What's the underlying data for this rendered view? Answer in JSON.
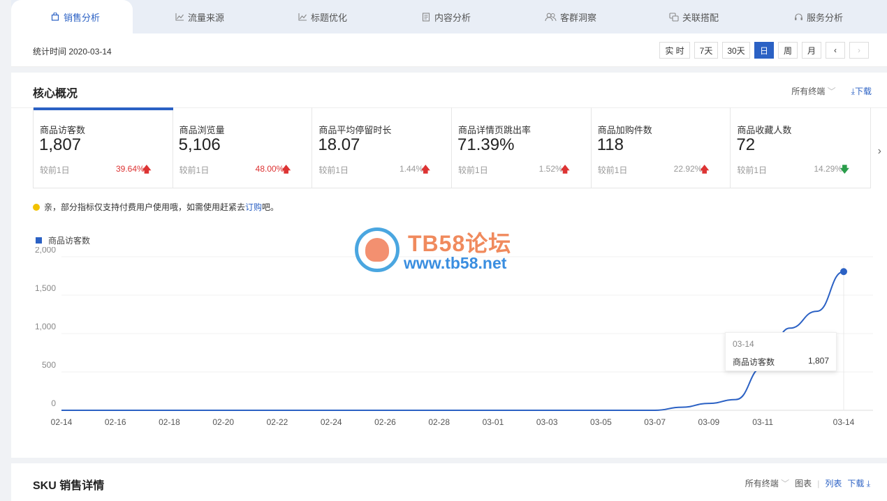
{
  "tabs": [
    {
      "label": "销售分析",
      "icon": "bag-icon",
      "active": true
    },
    {
      "label": "流量来源",
      "icon": "line-chart-icon"
    },
    {
      "label": "标题优化",
      "icon": "line-chart-icon"
    },
    {
      "label": "内容分析",
      "icon": "document-icon"
    },
    {
      "label": "客群洞察",
      "icon": "users-icon"
    },
    {
      "label": "关联搭配",
      "icon": "link-icon"
    },
    {
      "label": "服务分析",
      "icon": "headset-icon"
    }
  ],
  "header": {
    "stat_time": "统计时间 2020-03-14",
    "periods": [
      "实 时",
      "7天",
      "30天",
      "日",
      "周",
      "月"
    ],
    "active_period": "日",
    "prev": "‹",
    "next": "›"
  },
  "core": {
    "title": "核心概况",
    "terminal": "所有终端",
    "download": "下载",
    "cards": [
      {
        "label": "商品访客数",
        "value": "1,807",
        "compare": "较前1日",
        "pct": "39.64%",
        "trend": "up",
        "highlight": true
      },
      {
        "label": "商品浏览量",
        "value": "5,106",
        "compare": "较前1日",
        "pct": "48.00%",
        "trend": "up",
        "highlight": true
      },
      {
        "label": "商品平均停留时长",
        "value": "18.07",
        "compare": "较前1日",
        "pct": "1.44%",
        "trend": "up",
        "highlight": false
      },
      {
        "label": "商品详情页跳出率",
        "value": "71.39%",
        "compare": "较前1日",
        "pct": "1.52%",
        "trend": "up",
        "highlight": false
      },
      {
        "label": "商品加购件数",
        "value": "118",
        "compare": "较前1日",
        "pct": "22.92%",
        "trend": "up",
        "highlight": false
      },
      {
        "label": "商品收藏人数",
        "value": "72",
        "compare": "较前1日",
        "pct": "14.29%",
        "trend": "down",
        "highlight": false
      }
    ],
    "notice_pre": "亲，部分指标仅支持付费用户使用哦，如需使用赶紧去",
    "notice_link": "订购",
    "notice_post": "吧。"
  },
  "watermark": {
    "line1": "TB58论坛",
    "line2": "www.tb58.net"
  },
  "chart_data": {
    "type": "line",
    "series": [
      {
        "name": "商品访客数",
        "x": [
          "02-14",
          "02-15",
          "02-16",
          "02-17",
          "02-18",
          "02-19",
          "02-20",
          "02-21",
          "02-22",
          "02-23",
          "02-24",
          "02-25",
          "02-26",
          "02-27",
          "02-28",
          "02-29",
          "03-01",
          "03-02",
          "03-03",
          "03-04",
          "03-05",
          "03-06",
          "03-07",
          "03-08",
          "03-09",
          "03-10",
          "03-11",
          "03-12",
          "03-13",
          "03-14"
        ],
        "values": [
          0,
          0,
          0,
          0,
          0,
          0,
          0,
          0,
          0,
          0,
          0,
          0,
          0,
          0,
          0,
          0,
          0,
          0,
          0,
          0,
          0,
          0,
          0,
          40,
          90,
          140,
          560,
          1070,
          1290,
          1807
        ]
      }
    ],
    "x_tick_labels": [
      "02-14",
      "02-16",
      "02-18",
      "02-20",
      "02-22",
      "02-24",
      "02-26",
      "02-28",
      "03-01",
      "03-03",
      "03-05",
      "03-07",
      "03-09",
      "03-11",
      "03-14"
    ],
    "y_ticks": [
      "0",
      "500",
      "1,000",
      "1,500",
      "2,000"
    ],
    "ylim": [
      0,
      2000
    ],
    "grid": true,
    "legend": "top-left",
    "color": "#2b61c4",
    "tooltip": {
      "date": "03-14",
      "label": "商品访客数",
      "value": "1,807"
    }
  },
  "sku": {
    "title": "SKU 销售详情",
    "terminal": "所有终端",
    "chart_label": "图表",
    "list_label": "列表",
    "download": "下载"
  }
}
